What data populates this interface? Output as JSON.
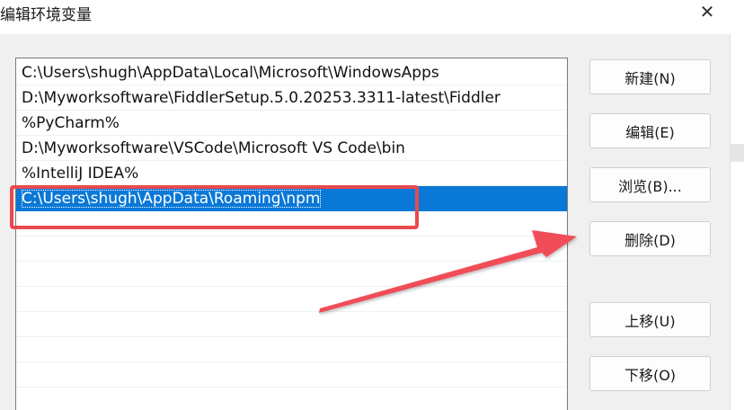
{
  "window": {
    "title": "编辑环境变量",
    "close_glyph": "✕"
  },
  "paths": [
    "C:\\Users\\shugh\\AppData\\Local\\Microsoft\\WindowsApps",
    "D:\\Myworksoftware\\FiddlerSetup.5.0.20253.3311-latest\\Fiddler",
    "%PyCharm%",
    "D:\\Myworksoftware\\VSCode\\Microsoft VS Code\\bin",
    "%IntelliJ IDEA%",
    "C:\\Users\\shugh\\AppData\\Roaming\\npm"
  ],
  "selected_index": 5,
  "buttons": {
    "new": "新建(N)",
    "edit": "编辑(E)",
    "browse": "浏览(B)...",
    "delete": "删除(D)",
    "move_up": "上移(U)",
    "move_down": "下移(O)"
  },
  "colors": {
    "selection": "#0a78d7",
    "annotation": "#e84a4f"
  }
}
